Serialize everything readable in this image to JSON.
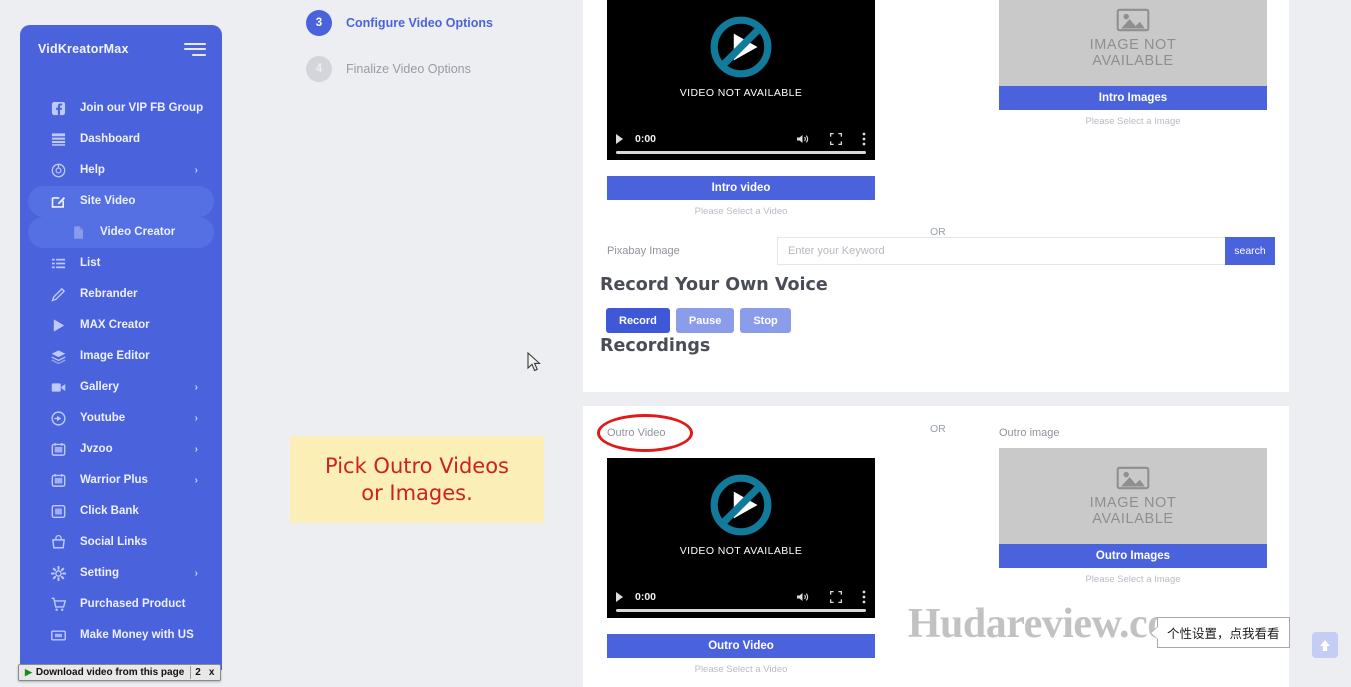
{
  "sidebar": {
    "brand": "VidKreatorMax",
    "menu_icon": "hamburger-icon",
    "items": [
      {
        "label": "Join our VIP FB Group",
        "icon": "facebook-icon",
        "caret": "",
        "state": "normal"
      },
      {
        "label": "Dashboard",
        "icon": "dashboard-icon",
        "caret": "",
        "state": "normal"
      },
      {
        "label": "Help",
        "icon": "help-circle-icon",
        "caret": "›",
        "state": "normal"
      },
      {
        "label": "Site Video",
        "icon": "edit-square-icon",
        "caret": "",
        "state": "active"
      },
      {
        "label": "Video Creator",
        "icon": "file-icon",
        "caret": "",
        "state": "sub"
      },
      {
        "label": "List",
        "icon": "list-icon",
        "caret": "",
        "state": "normal"
      },
      {
        "label": "Rebrander",
        "icon": "pencil-icon",
        "caret": "",
        "state": "normal"
      },
      {
        "label": "MAX Creator",
        "icon": "play-icon",
        "caret": "",
        "state": "normal"
      },
      {
        "label": "Image Editor",
        "icon": "layers-icon",
        "caret": "",
        "state": "normal"
      },
      {
        "label": "Gallery",
        "icon": "video-camera-icon",
        "caret": "›",
        "state": "normal"
      },
      {
        "label": "Youtube",
        "icon": "youtube-icon",
        "caret": "›",
        "state": "normal"
      },
      {
        "label": "Jvzoo",
        "icon": "jvzoo-icon",
        "caret": "›",
        "state": "normal"
      },
      {
        "label": "Warrior Plus",
        "icon": "warriorplus-icon",
        "caret": "›",
        "state": "normal"
      },
      {
        "label": "Click Bank",
        "icon": "clickbank-icon",
        "caret": "",
        "state": "normal"
      },
      {
        "label": "Social Links",
        "icon": "social-links-icon",
        "caret": "",
        "state": "normal"
      },
      {
        "label": "Setting",
        "icon": "gear-icon",
        "caret": "›",
        "state": "normal"
      },
      {
        "label": "Purchased Product",
        "icon": "cart-icon",
        "caret": "",
        "state": "normal"
      },
      {
        "label": "Make Money with US",
        "icon": "money-icon",
        "caret": "",
        "state": "normal"
      }
    ]
  },
  "download_bar": {
    "label": "Download video from this page",
    "count": "2",
    "close": "x"
  },
  "steps": [
    {
      "number": "3",
      "label": "Configure Video Options",
      "state": "done"
    },
    {
      "number": "4",
      "label": "Finalize Video Options",
      "state": "todo"
    }
  ],
  "callout": {
    "line1": "Pick Outro Videos",
    "line2": "or Images."
  },
  "intro": {
    "video": {
      "placeholder_text": "VIDEO NOT AVAILABLE",
      "time": "0:00",
      "button": "Intro video",
      "helper": "Please Select a Video"
    },
    "image": {
      "placeholder_line1": "IMAGE NOT",
      "placeholder_line2": "AVAILABLE",
      "button": "Intro Images",
      "helper": "Please Select a Image"
    },
    "or": "OR"
  },
  "pixabay": {
    "label": "Pixabay Image",
    "input_value": "",
    "placeholder": "Enter your Keyword",
    "search_button": "search"
  },
  "record": {
    "title": "Record Your Own Voice",
    "buttons": [
      {
        "label": "Record",
        "color": "#3f58d8"
      },
      {
        "label": "Pause",
        "color": "#8b9cea"
      },
      {
        "label": "Stop",
        "color": "#8b9cea"
      }
    ],
    "recordings_title": "Recordings"
  },
  "outro": {
    "video_label": "Outro Video",
    "image_label": "Outro image",
    "or": "OR",
    "video": {
      "placeholder_text": "VIDEO NOT AVAILABLE",
      "time": "0:00",
      "button": "Outro Video",
      "helper": "Please Select a Video"
    },
    "image": {
      "placeholder_line1": "IMAGE NOT",
      "placeholder_line2": "AVAILABLE",
      "button": "Outro Images",
      "helper": "Please Select a Image"
    }
  },
  "watermark": "Hudareview.com",
  "tooltip_cn": "个性设置，点我看看",
  "colors": {
    "brand_blue": "#4a63dd",
    "sidebar_blue": "#4a63dd",
    "annotation_red": "#e11919",
    "callout_bg": "#fbeeb6"
  }
}
